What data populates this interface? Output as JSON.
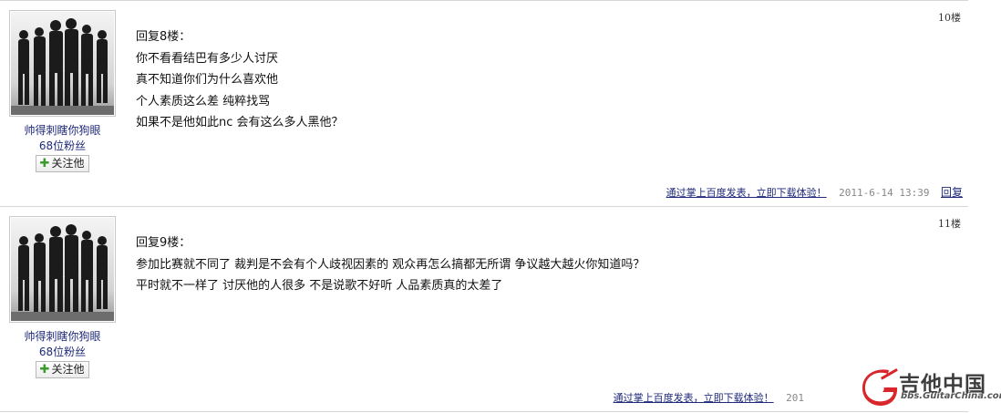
{
  "posts": [
    {
      "author": {
        "name": "帅得刺瞎你狗眼",
        "fans": "68位粉丝",
        "follow_label": "关注他",
        "avatar_icon": "band-photo-avatar"
      },
      "floor": "10楼",
      "lines": [
        "回复8楼：",
        "你不看看结巴有多少人讨厌",
        "真不知道你们为什么喜欢他",
        "个人素质这么差  纯粹找骂",
        "如果不是他如此nc  会有这么多人黑他？"
      ],
      "footer": {
        "promo": "通过掌上百度发表，立即下载体验！",
        "time": "2011-6-14 13:39",
        "reply": "回复"
      }
    },
    {
      "author": {
        "name": "帅得刺瞎你狗眼",
        "fans": "68位粉丝",
        "follow_label": "关注他",
        "avatar_icon": "band-photo-avatar"
      },
      "floor": "11楼",
      "lines": [
        "回复9楼：",
        "参加比赛就不同了  裁判是不会有个人歧视因素的  观众再怎么搞都无所谓  争议越大越火你知道吗？",
        "平时就不一样了  讨厌他的人很多  不是说歌不好听  人品素质真的太差了"
      ],
      "footer": {
        "promo": "通过掌上百度发表，立即下载体验！",
        "time": "201",
        "reply": ""
      }
    }
  ],
  "watermark": {
    "title": "吉他中国",
    "subtitle": "bbs.GuitarChina.com",
    "colors": {
      "logo_red": "#d8262b",
      "text": "#3e3e3e"
    }
  },
  "colors": {
    "link": "#1f2a7a",
    "divider": "#d7d7d7",
    "time": "#888888",
    "plus": "#3a9a2b"
  }
}
